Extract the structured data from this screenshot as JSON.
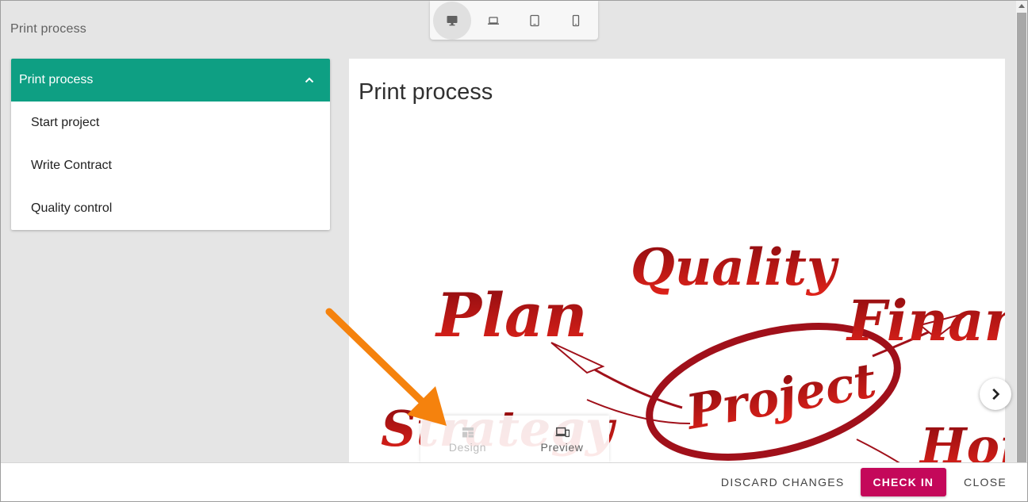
{
  "page": {
    "title": "Print process"
  },
  "device_bar": {
    "items": [
      {
        "icon": "desktop-icon",
        "active": true
      },
      {
        "icon": "laptop-icon",
        "active": false
      },
      {
        "icon": "tablet-icon",
        "active": false
      },
      {
        "icon": "phone-icon",
        "active": false
      }
    ]
  },
  "nav": {
    "header": "Print process",
    "items": [
      {
        "label": "Start project"
      },
      {
        "label": "Write Contract"
      },
      {
        "label": "Quality control"
      }
    ]
  },
  "content": {
    "title": "Print process",
    "mindmap_words": {
      "plan": "Plan",
      "quality": "Quality",
      "finance": "Finan",
      "strategy": "Strategy",
      "project": "Project",
      "hon": "Hon"
    }
  },
  "mode_switch": {
    "design_label": "Design",
    "preview_label": "Preview"
  },
  "footer": {
    "discard_label": "DISCARD CHANGES",
    "checkin_label": "CHECK IN",
    "close_label": "CLOSE"
  },
  "colors": {
    "accent_green": "#0e9f83",
    "primary_button": "#c4085a",
    "annotation_arrow": "#f5820d",
    "mindmap_red": "#b0141c"
  }
}
